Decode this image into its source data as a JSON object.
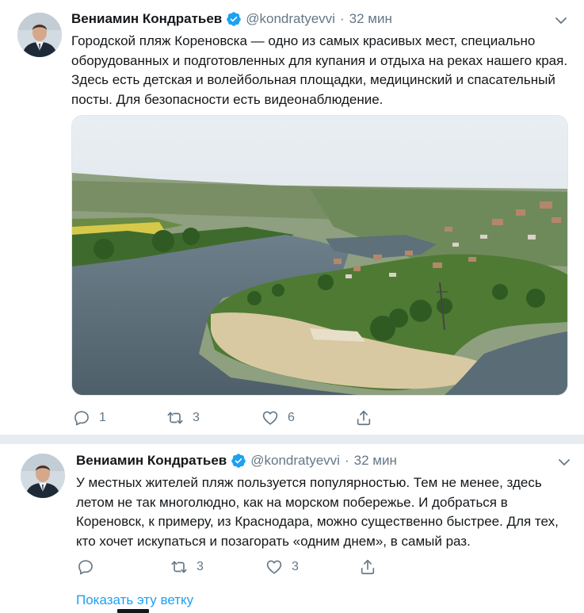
{
  "tweets": [
    {
      "author_name": "Вениамин Кондратьев",
      "handle": "@kondratyevvi",
      "separator": "·",
      "time": "32 мин",
      "text": "Городской пляж Кореновска — одно из самых красивых мест, специально оборудованных и подготовленных для купания и отдыха на реках нашего края. Здесь есть детская и волейбольная площадки, медицинский и спасательный посты. Для безопасности есть видеонаблюдение.",
      "replies": "1",
      "retweets": "3",
      "likes": "6"
    },
    {
      "author_name": "Вениамин Кондратьев",
      "handle": "@kondratyevvi",
      "separator": "·",
      "time": "32 мин",
      "text": "У местных жителей пляж пользуется популярностью. Тем не менее, здесь летом не так многолюдно, как на морском побережье. И добраться в Кореновск, к примеру, из Краснодара, можно существенно быстрее. Для тех, кто хочет искупаться и позагорать «одним днем», в самый раз.",
      "replies": "",
      "retweets": "3",
      "likes": "3"
    }
  ],
  "show_thread_label": "Показать эту ветку",
  "icons": {
    "verified": "verified-badge-icon",
    "caret": "chevron-down-icon",
    "reply": "reply-icon",
    "retweet": "retweet-icon",
    "like": "heart-icon",
    "share": "share-icon"
  },
  "colors": {
    "link": "#1da1f2",
    "muted": "#657786",
    "text": "#14171a",
    "divider": "#e6ecf0"
  }
}
